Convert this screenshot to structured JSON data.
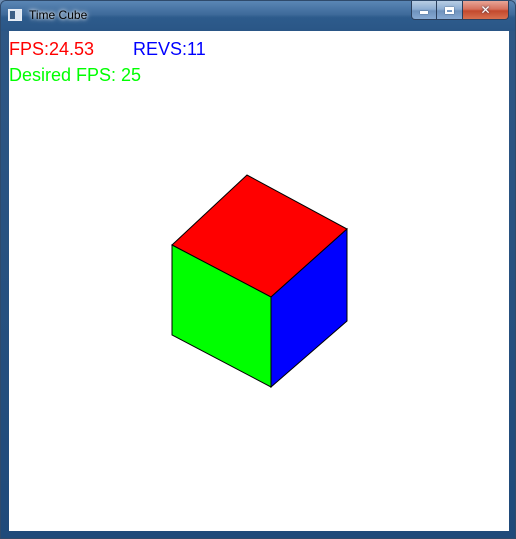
{
  "window": {
    "title": "Time Cube",
    "buttons": {
      "minimize_icon": "minimize-icon",
      "maximize_icon": "maximize-icon",
      "close_glyph": "✕"
    }
  },
  "hud": {
    "fps_label": "FPS:24.53",
    "revs_label": "REVS:11",
    "desired_fps_label": "Desired FPS: 25",
    "colors": {
      "fps": "#ff0000",
      "revs": "#0000ff",
      "desired": "#00ff00"
    }
  },
  "cube": {
    "faces": {
      "top": "#ff0000",
      "front": "#00ff00",
      "side": "#0000ff"
    },
    "edge_color": "#000000"
  }
}
